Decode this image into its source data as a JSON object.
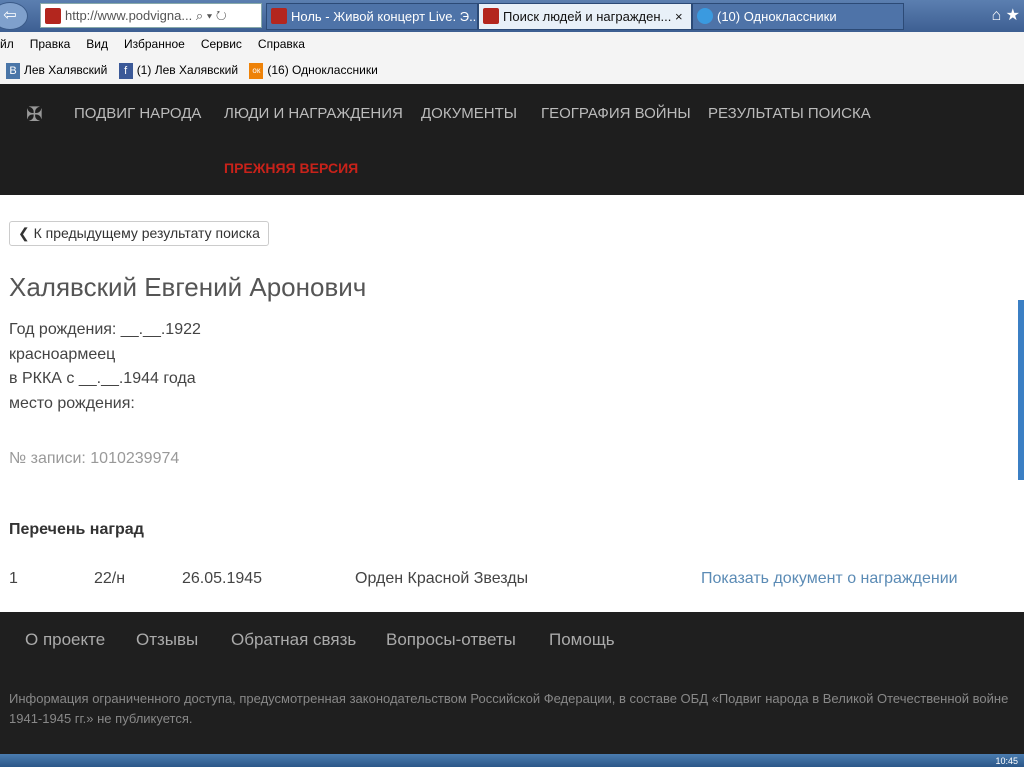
{
  "browser": {
    "url": "http://www.podvigna...",
    "tabs": [
      "Ноль - Живой концерт Live. Э...",
      "Поиск людей и награжден...",
      "(10) Одноклассники"
    ],
    "menu": [
      "йл",
      "Правка",
      "Вид",
      "Избранное",
      "Сервис",
      "Справка"
    ],
    "favorites": [
      {
        "icon": "В",
        "label": "Лев Халявский",
        "color": "#4a76a8"
      },
      {
        "icon": "f",
        "label": "(1) Лев Халявский",
        "color": "#3b5998"
      },
      {
        "icon": "ок",
        "label": "(16) Одноклассники",
        "color": "#ee8208"
      }
    ]
  },
  "nav": {
    "items": [
      "ПОДВИГ НАРОДА",
      "ЛЮДИ И НАГРАЖДЕНИЯ",
      "ДОКУМЕНТЫ",
      "ГЕОГРАФИЯ ВОЙНЫ",
      "РЕЗУЛЬТАТЫ ПОИСКА"
    ],
    "old_version": "ПРЕЖНЯЯ ВЕРСИЯ"
  },
  "back_button": "К предыдущему результату поиска",
  "person": {
    "name": "Халявский Евгений Аронович",
    "lines": [
      "Год рождения: __.__.1922",
      "красноармеец",
      "в РККА с __.__.1944 года",
      "место рождения:"
    ],
    "record": "№ записи: 1010239974"
  },
  "awards": {
    "title": "Перечень наград",
    "rows": [
      {
        "num": "1",
        "doc": "22/н",
        "date": "26.05.1945",
        "name": "Орден Красной Звезды",
        "link": "Показать документ о награждении"
      }
    ]
  },
  "footer": {
    "links": [
      "О проекте",
      "Отзывы",
      "Обратная связь",
      "Вопросы-ответы",
      "Помощь"
    ],
    "note": "Информация ограниченного доступа, предусмотренная законодательством Российской Федерации, в составе ОБД «Подвиг народа в Великой Отечественной войне 1941-1945 гг.» не публикуется."
  },
  "taskbar": {
    "clock": "10:45"
  }
}
